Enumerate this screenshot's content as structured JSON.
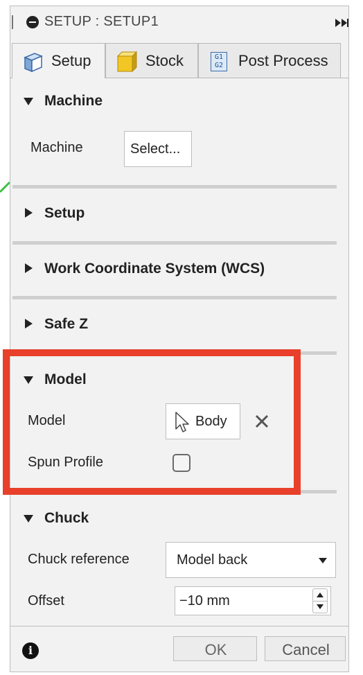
{
  "window": {
    "title": "SETUP : SETUP1"
  },
  "tabs": [
    {
      "label": "Setup",
      "icon": "setup-icon",
      "active": true
    },
    {
      "label": "Stock",
      "icon": "stock-icon",
      "active": false
    },
    {
      "label": "Post Process",
      "icon": "gcode-icon",
      "active": false
    }
  ],
  "gcode_icon_text": {
    "line1": "G1",
    "line2": "G2"
  },
  "sections": {
    "machine": {
      "title": "Machine",
      "field_label": "Machine",
      "button": "Select..."
    },
    "setup": {
      "title": "Setup"
    },
    "wcs": {
      "title": "Work Coordinate System (WCS)"
    },
    "safez": {
      "title": "Safe Z"
    },
    "model": {
      "title": "Model",
      "model_label": "Model",
      "model_value": "Body",
      "spun_label": "Spun Profile",
      "spun_checked": false
    },
    "chuck": {
      "title": "Chuck",
      "reference_label": "Chuck reference",
      "reference_value": "Model back",
      "offset_label": "Offset",
      "offset_value": "−10 mm"
    }
  },
  "footer": {
    "ok": "OK",
    "cancel": "Cancel"
  },
  "colors": {
    "highlight": "#e8402a",
    "panel": "#f2f2f2",
    "stock_cube": "#f2c624",
    "setup_cube": "#4a7bb8"
  }
}
